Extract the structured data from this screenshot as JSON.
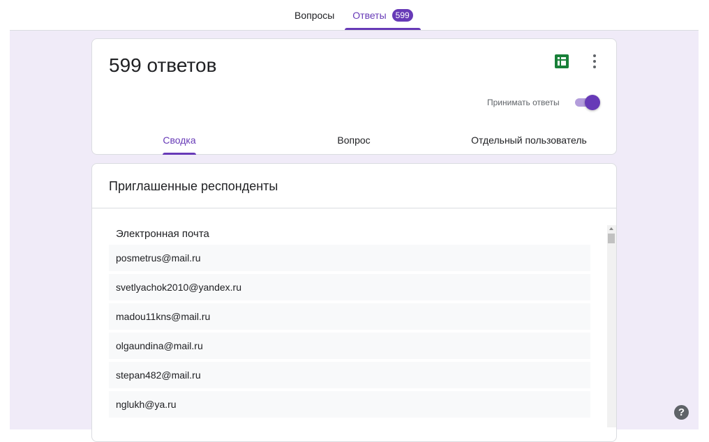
{
  "nav": {
    "tabs": [
      {
        "label": "Вопросы"
      },
      {
        "label": "Ответы",
        "badge": "599"
      }
    ]
  },
  "summary": {
    "title": "599 ответов",
    "accept_label": "Принимать ответы",
    "accepting": true,
    "subtabs": [
      {
        "label": "Сводка"
      },
      {
        "label": "Вопрос"
      },
      {
        "label": "Отдельный пользователь"
      }
    ]
  },
  "invited": {
    "title": "Приглашенные респонденты",
    "column_header": "Электронная почта",
    "emails": [
      "posmetrus@mail.ru",
      "svetlyachok2010@yandex.ru",
      "madou11kns@mail.ru",
      "olgaundina@mail.ru",
      "stepan482@mail.ru",
      "nglukh@ya.ru"
    ]
  },
  "help": {
    "glyph": "?"
  },
  "icons": {
    "sheets": "sheets-icon",
    "more": "more-vert-icon",
    "help": "help-icon"
  },
  "colors": {
    "accent": "#673ab7",
    "background": "#f0ebf8",
    "sheets_green": "#188038"
  }
}
